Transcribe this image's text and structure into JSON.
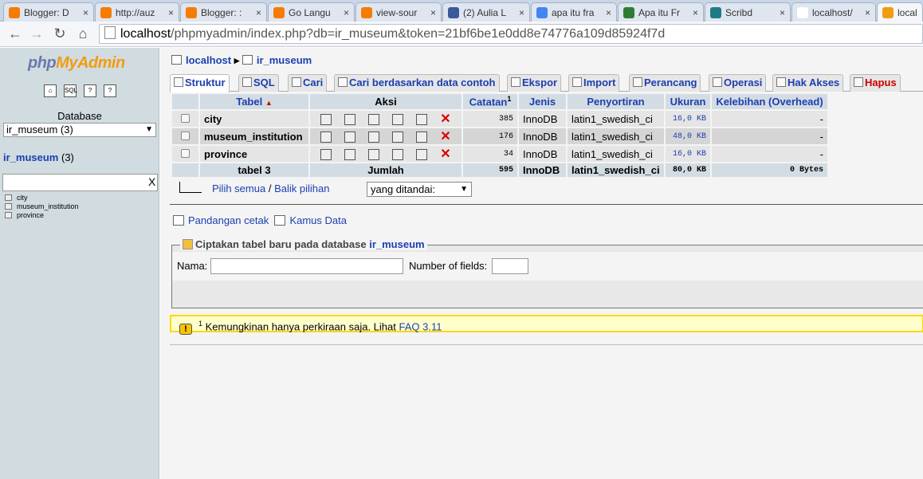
{
  "browser": {
    "tabs": [
      {
        "title": "Blogger: D",
        "icon": "blogger-icon",
        "color": "#f57c00"
      },
      {
        "title": "http://auz",
        "icon": "blogger-icon",
        "color": "#f57c00"
      },
      {
        "title": "Blogger: :",
        "icon": "blogger-icon",
        "color": "#f57c00"
      },
      {
        "title": "Go Langu",
        "icon": "blogger-icon",
        "color": "#f57c00"
      },
      {
        "title": "view-sour",
        "icon": "blogger-icon",
        "color": "#f57c00"
      },
      {
        "title": "(2) Aulia L",
        "icon": "facebook-icon",
        "color": "#3b5998"
      },
      {
        "title": "apa itu fra",
        "icon": "google-icon",
        "color": "#4285f4"
      },
      {
        "title": "Apa itu Fr",
        "icon": "generic-site-icon",
        "color": "#2e7d32"
      },
      {
        "title": "Scribd",
        "icon": "scribd-icon",
        "color": "#1e7b85"
      },
      {
        "title": "localhost/",
        "icon": "page-icon",
        "color": "#ffffff"
      },
      {
        "title": "localh",
        "icon": "phpmyadmin-icon",
        "color": "#f29c11"
      }
    ],
    "url_host": "localhost",
    "url_path": "/phpmyadmin/index.php?db=ir_museum&token=21bf6be1e0dd8e74776a109d85924f7d"
  },
  "sidebar": {
    "logo_php": "php",
    "logo_myadmin": "MyAdmin",
    "icons": [
      "home-icon",
      "sql-icon",
      "help-icon",
      "docs-icon"
    ],
    "database_label": "Database",
    "database_select": "ir_museum (3)",
    "db_name": "ir_museum",
    "db_count": "(3)",
    "filter_clear": "X",
    "tables": [
      "city",
      "museum_institution",
      "province"
    ]
  },
  "breadcrumb": {
    "server": "localhost",
    "database": "ir_museum"
  },
  "tabs": [
    {
      "label": "Struktur",
      "icon": "structure-icon"
    },
    {
      "label": "SQL",
      "icon": "sql-icon"
    },
    {
      "label": "Cari",
      "icon": "search-icon"
    },
    {
      "label": "Cari berdasarkan data contoh",
      "icon": "query-icon"
    },
    {
      "label": "Ekspor",
      "icon": "export-icon"
    },
    {
      "label": "Import",
      "icon": "import-icon"
    },
    {
      "label": "Perancang",
      "icon": "designer-icon"
    },
    {
      "label": "Operasi",
      "icon": "operations-icon"
    },
    {
      "label": "Hak Akses",
      "icon": "privileges-icon"
    },
    {
      "label": "Hapus",
      "icon": "drop-icon"
    }
  ],
  "table": {
    "headers": {
      "tabel": "Tabel",
      "sort_indicator": "▲",
      "aksi": "Aksi",
      "catatan": "Catatan",
      "catatan_sup": "1",
      "jenis": "Jenis",
      "penyortiran": "Penyortiran",
      "ukuran": "Ukuran",
      "kelebihan": "Kelebihan (Overhead)"
    },
    "actions": [
      "browse-icon",
      "structure-icon",
      "search-icon",
      "insert-icon",
      "empty-icon",
      "drop-icon"
    ],
    "rows": [
      {
        "name": "city",
        "records": "385",
        "type": "InnoDB",
        "collation": "latin1_swedish_ci",
        "size": "16,0 KB",
        "overhead": "-"
      },
      {
        "name": "museum_institution",
        "records": "176",
        "type": "InnoDB",
        "collation": "latin1_swedish_ci",
        "size": "48,0 KB",
        "overhead": "-"
      },
      {
        "name": "province",
        "records": "34",
        "type": "InnoDB",
        "collation": "latin1_swedish_ci",
        "size": "16,0 KB",
        "overhead": "-"
      }
    ],
    "footer": {
      "name": "tabel 3",
      "label": "Jumlah",
      "records": "595",
      "type": "InnoDB",
      "collation": "latin1_swedish_ci",
      "size": "80,0 KB",
      "overhead": "0 Bytes"
    }
  },
  "selection": {
    "check_all": "Pilih semua",
    "separator": "/",
    "invert": "Balik pilihan",
    "with_selected": "yang ditandai:"
  },
  "links": {
    "print_view": "Pandangan cetak",
    "data_dictionary": "Kamus Data"
  },
  "create_table": {
    "legend": "Ciptakan tabel baru pada database",
    "database": "ir_museum",
    "name_label": "Nama:",
    "fields_label": "Number of fields:"
  },
  "notice": {
    "sup": "1",
    "text": "Kemungkinan hanya perkiraan saja. Lihat",
    "link": "FAQ 3.11"
  }
}
